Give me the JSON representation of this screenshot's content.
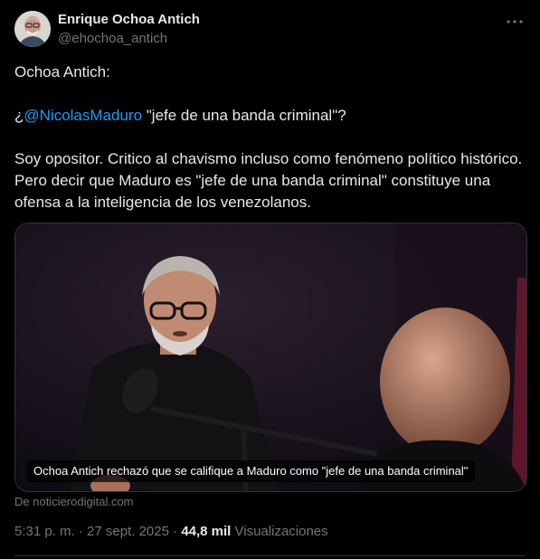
{
  "author": {
    "name": "Enrique Ochoa Antich",
    "handle": "@ehochoa_antich"
  },
  "tweet": {
    "line1": "Ochoa Antich:",
    "question_prefix": "¿",
    "mention": "@NicolasMaduro",
    "question_suffix": " \"jefe de una banda criminal\"?",
    "paragraph": "Soy opositor. Critico al chavismo incluso como fenómeno político histórico. Pero decir que Maduro es \"jefe de una banda criminal\" constituye una ofensa a la inteligencia de los venezolanos."
  },
  "media": {
    "caption": "Ochoa Antich rechazó que se califique a Maduro como \"jefe de una banda criminal\"",
    "source": "De noticierodigital.com"
  },
  "meta": {
    "time": "5:31 p. m.",
    "separator": " · ",
    "date": "27 sept. 2025",
    "views_count": "44,8 mil",
    "views_label": "Visualizaciones"
  },
  "icons": {
    "more": "more-options-icon"
  }
}
